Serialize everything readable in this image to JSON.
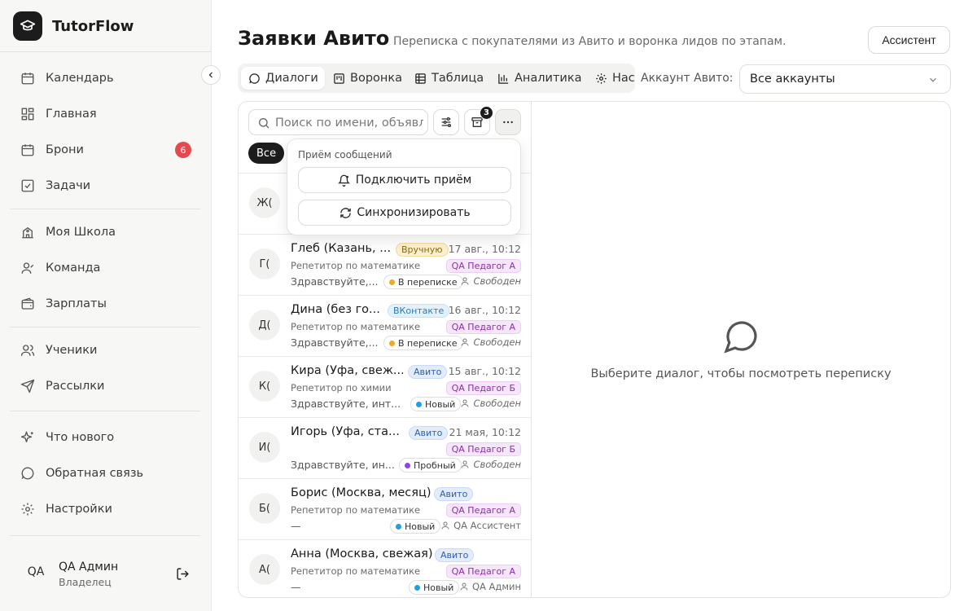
{
  "app": {
    "name": "TutorFlow"
  },
  "sidebar": {
    "items": [
      {
        "label": "Календарь",
        "icon": "calendar-icon"
      },
      {
        "label": "Главная",
        "icon": "dashboard-icon"
      },
      {
        "label": "Брони",
        "icon": "calendar-icon",
        "badge": "6"
      },
      {
        "label": "Задачи",
        "icon": "checkbox-icon"
      },
      {
        "label": "Моя Школа",
        "icon": "school-icon"
      },
      {
        "label": "Команда",
        "icon": "user-icon"
      },
      {
        "label": "Зарплаты",
        "icon": "wallet-icon"
      },
      {
        "label": "Ученики",
        "icon": "users-icon"
      },
      {
        "label": "Рассылки",
        "icon": "send-icon"
      },
      {
        "label": "Что нового",
        "icon": "sparkles-icon"
      },
      {
        "label": "Обратная связь",
        "icon": "message-circle-icon"
      },
      {
        "label": "Настройки",
        "icon": "gear-icon"
      }
    ],
    "user": {
      "initials": "QA",
      "name": "QA Админ",
      "role": "Владелец"
    }
  },
  "header": {
    "title": "Заявки Авито",
    "subtitle": "Переписка с покупателями из Авито и воронка лидов по этапам.",
    "assistant_label": "Ассистент"
  },
  "tabs": [
    {
      "label": "Диалоги",
      "icon": "message-circle-icon",
      "active": true
    },
    {
      "label": "Воронка",
      "icon": "kanban-icon"
    },
    {
      "label": "Таблица",
      "icon": "table-icon"
    },
    {
      "label": "Аналитика",
      "icon": "bar-chart-icon"
    },
    {
      "label": "Нас",
      "icon": "gear-icon"
    }
  ],
  "account": {
    "label": "Аккаунт Авито:",
    "value": "Все аккаунты"
  },
  "list": {
    "search_placeholder": "Поиск по имени, объявлению",
    "archive_count": "3",
    "filter_all": "Все",
    "rows": [
      {
        "initials": "Ж("
      },
      {
        "initials": "Г(",
        "name": "Глеб (Казань, ...",
        "source": "Вручную",
        "source_type": "manual",
        "time": "17 авг., 10:12",
        "subject": "Репетитор по математике",
        "teacher": "QA Педагог А",
        "message": "Здравствуйте,...",
        "status": "В переписке",
        "status_color": "#f5a623",
        "owner": "Свободен",
        "owner_italic": true
      },
      {
        "initials": "Д(",
        "name": "Дина (без го...",
        "source": "ВКонтакте",
        "source_type": "vk",
        "time": "16 авг., 10:12",
        "subject": "Репетитор по математике",
        "teacher": "QA Педагог А",
        "message": "Здравствуйте,...",
        "status": "В переписке",
        "status_color": "#f5a623",
        "owner": "Свободен",
        "owner_italic": true
      },
      {
        "initials": "К(",
        "name": "Кира (Уфа, свеж...",
        "source": "Авито",
        "source_type": "avito",
        "time": "15 авг., 10:12",
        "subject": "Репетитор по химии",
        "teacher": "QA Педагог Б",
        "message": "Здравствуйте, инт...",
        "status": "Новый",
        "status_color": "#1da1e2",
        "owner": "Свободен",
        "owner_italic": true
      },
      {
        "initials": "И(",
        "name": "Игорь (Уфа, ста...",
        "source": "Авито",
        "source_type": "avito",
        "time": "21 мая, 10:12",
        "subject": "",
        "teacher": "QA Педагог Б",
        "message": "Здравствуйте, ин...",
        "status": "Пробный",
        "status_color": "#8e44ec",
        "owner": "Свободен",
        "owner_italic": true
      },
      {
        "initials": "Б(",
        "name": "Борис (Москва, месяц)",
        "source": "Авито",
        "source_type": "avito",
        "time": "",
        "subject": "Репетитор по математике",
        "teacher": "QA Педагог А",
        "message": "—",
        "status": "Новый",
        "status_color": "#1da1e2",
        "owner": "QA Ассистент",
        "owner_italic": false
      },
      {
        "initials": "А(",
        "name": "Анна (Москва, свежая)",
        "source": "Авито",
        "source_type": "avito",
        "time": "",
        "subject": "Репетитор по математике",
        "teacher": "QA Педагог А",
        "message": "—",
        "status": "Новый",
        "status_color": "#1da1e2",
        "owner": "QA Админ",
        "owner_italic": false
      }
    ]
  },
  "dropdown": {
    "title": "Приём сообщений",
    "connect_label": "Подключить приём",
    "sync_label": "Синхронизировать"
  },
  "empty_state": {
    "text": "Выберите диалог, чтобы посмотреть переписку"
  }
}
